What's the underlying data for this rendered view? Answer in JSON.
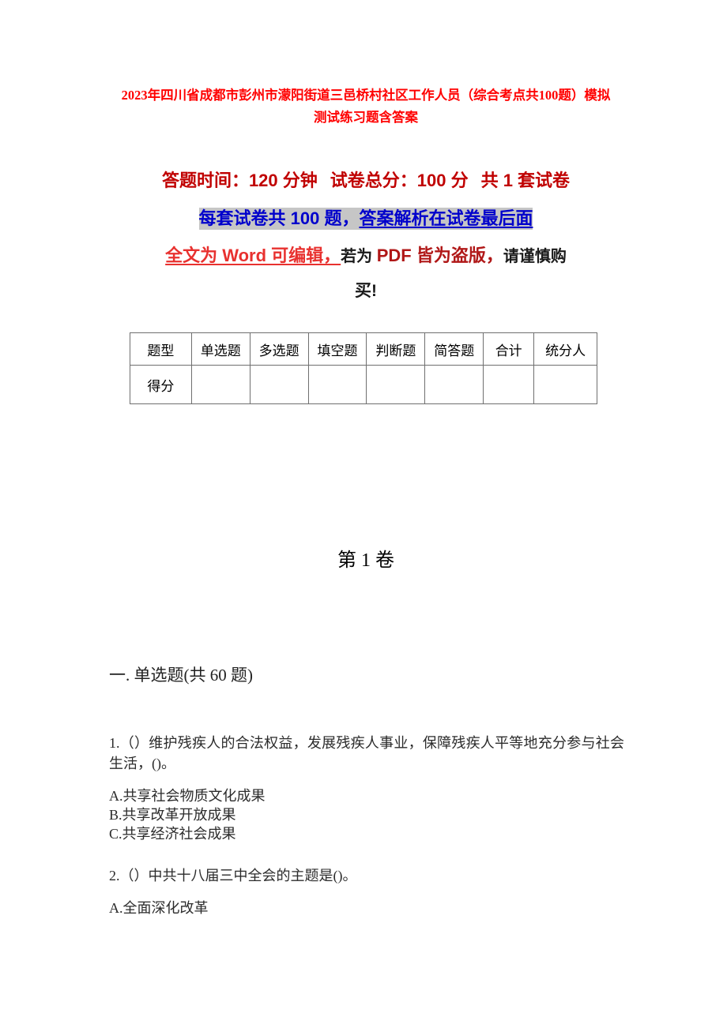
{
  "document": {
    "title": "2023年四川省成都市彭州市濛阳街道三邑桥村社区工作人员（综合考点共100题）模拟测试练习题含答案",
    "exam_info": {
      "duration_label": "答题时间：120 分钟",
      "total_score_label": "试卷总分：100 分",
      "paper_count_label": "共 1 套试卷",
      "questions_per_paper": "每套试卷共 100 题，",
      "answers_location": "答案解析在试卷最后面"
    },
    "notice": {
      "word_editable": "全文为 Word 可编辑，",
      "if_for": "若为 ",
      "pdf_pirated": "PDF 皆为盗版，",
      "caution": "请谨慎购",
      "caution_end": "买!"
    },
    "score_table": {
      "headers": [
        "题型",
        "单选题",
        "多选题",
        "填空题",
        "判断题",
        "简答题",
        "合计",
        "统分人"
      ],
      "rows": [
        {
          "label": "得分",
          "values": [
            "",
            "",
            "",
            "",
            "",
            "",
            ""
          ]
        }
      ]
    },
    "volume_heading": "第 1 卷",
    "sections": [
      {
        "heading": "一. 单选题(共 60 题)",
        "questions": [
          {
            "number": "1.",
            "stem": "1.（）维护残疾人的合法权益，发展残疾人事业，保障残疾人平等地充分参与社会生活，()。",
            "options": [
              "A.共享社会物质文化成果",
              "B.共享改革开放成果",
              "C.共享经济社会成果"
            ]
          },
          {
            "number": "2.",
            "stem": "2.（）中共十八届三中全会的主题是()。",
            "options": [
              "A.全面深化改革"
            ]
          }
        ]
      }
    ],
    "colors": {
      "title_red": "#FF0000",
      "header_dark_red": "#C00000",
      "link_blue": "#0000CC",
      "highlight_gray": "#C6C6C6",
      "bright_red": "#E8312F"
    }
  }
}
